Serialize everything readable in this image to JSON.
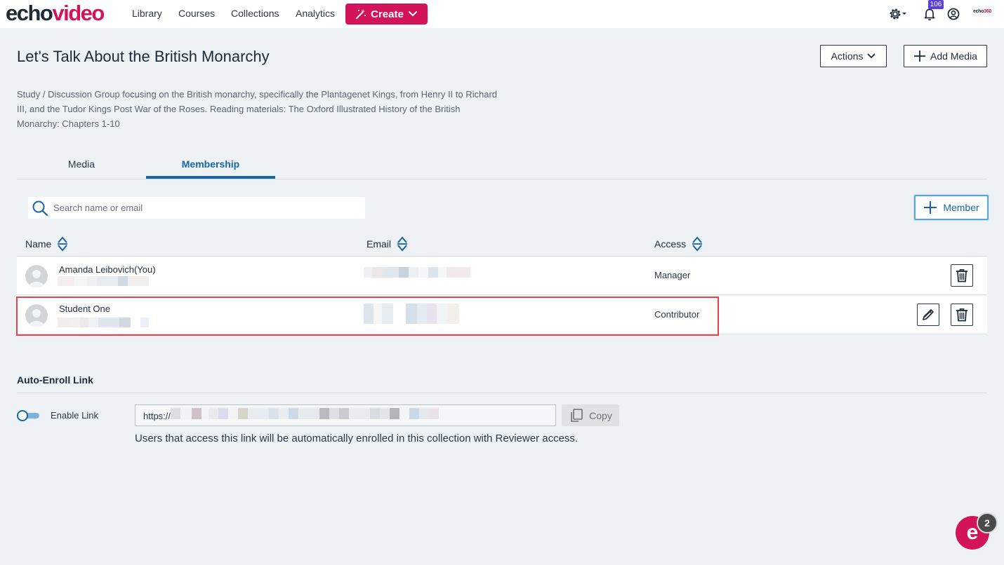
{
  "brand": {
    "echo": "echo",
    "video": "video",
    "small_logo_a": "echo",
    "small_logo_b": "360"
  },
  "nav": {
    "items": [
      {
        "label": "Library"
      },
      {
        "label": "Courses"
      },
      {
        "label": "Collections"
      },
      {
        "label": "Analytics"
      }
    ],
    "create_label": "Create"
  },
  "header_icons": {
    "notification_count": "106"
  },
  "page": {
    "title": "Let's Talk About the British Monarchy",
    "actions_label": "Actions",
    "add_media_label": "Add Media",
    "description": "Study / Discussion Group focusing on the British monarchy, specifically the Plantagenet Kings, from Henry II to Richard III, and the Tudor Kings Post War of the Roses. Reading materials: The Oxford Illustrated History of the British Monarchy: Chapters 1-10"
  },
  "tabs": [
    {
      "label": "Media",
      "active": false
    },
    {
      "label": "Membership",
      "active": true
    }
  ],
  "membership": {
    "search_placeholder": "Search name or email",
    "add_member_label": "Member",
    "columns": {
      "name": "Name",
      "email": "Email",
      "access": "Access"
    },
    "rows": [
      {
        "name": "Amanda Leibovich(You)",
        "access": "Manager"
      },
      {
        "name": "Student One",
        "access": "Contributor"
      }
    ]
  },
  "auto_enroll": {
    "title": "Auto-Enroll Link",
    "enable_label": "Enable Link",
    "link_prefix": "https://",
    "copy_label": "Copy",
    "note": "Users that access this link will be automatically enrolled in this collection with Reviewer access."
  },
  "help_fab": {
    "letter": "e",
    "badge": "2"
  },
  "colors": {
    "brand": "#d4145a",
    "link_blue": "#1565a8",
    "highlight": "#e8434a",
    "background": "#eff2f5"
  }
}
